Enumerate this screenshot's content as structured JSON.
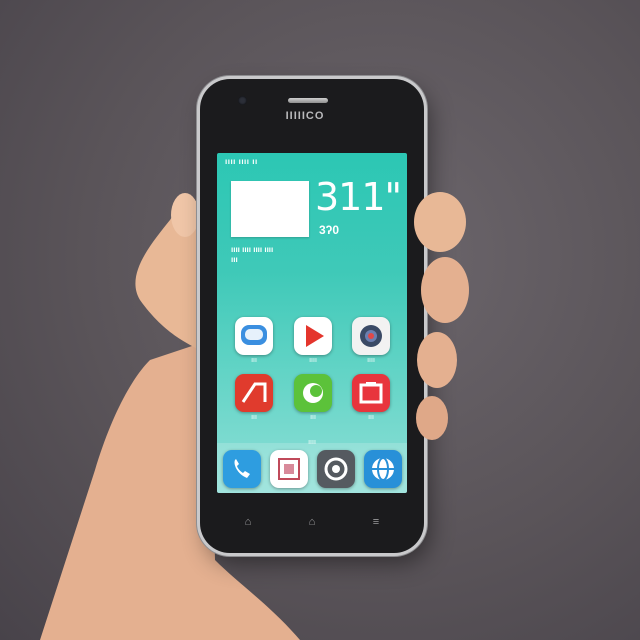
{
  "phone": {
    "brand": "IIIIICO"
  },
  "screen": {
    "status_text": "ıııı ıııı ıı",
    "clock_time": "311\"",
    "clock_sub": "3ʔ0",
    "date_line_1": "ıııı ıııı ıııı ıııı",
    "date_line_2": "ııı"
  },
  "apps": [
    {
      "name": "chat-app-icon",
      "label": "ııı",
      "color": "#3b8fe0"
    },
    {
      "name": "video-play-app-icon",
      "label": "ıııı",
      "color": "#ffffff"
    },
    {
      "name": "camera-app-icon",
      "label": "ıııı",
      "color": "#f2f2f2"
    },
    {
      "name": "red-app-icon",
      "label": "ııı",
      "color": "#e03b2d"
    },
    {
      "name": "green-app-icon",
      "label": "ııı",
      "color": "#5cc23a"
    },
    {
      "name": "frame-app-icon",
      "label": "ııı",
      "color": "#e8353d"
    }
  ],
  "dock": {
    "label": "ıııı",
    "apps": [
      {
        "name": "phone-app-icon",
        "color": "#2e9de0"
      },
      {
        "name": "gallery-app-icon",
        "color": "#ffffff"
      },
      {
        "name": "browser-app-icon",
        "color": "#555a60"
      },
      {
        "name": "globe-app-icon",
        "color": "#2890d8"
      }
    ]
  },
  "nav": {
    "back": "⌂",
    "home": "⌂",
    "menu": "≡"
  },
  "colors": {
    "background": "#5a5459",
    "screen_top": "#2cc7b4",
    "screen_bottom": "#8edfd7",
    "phone_body": "#1b1b1d",
    "skin": "#e8b896"
  }
}
